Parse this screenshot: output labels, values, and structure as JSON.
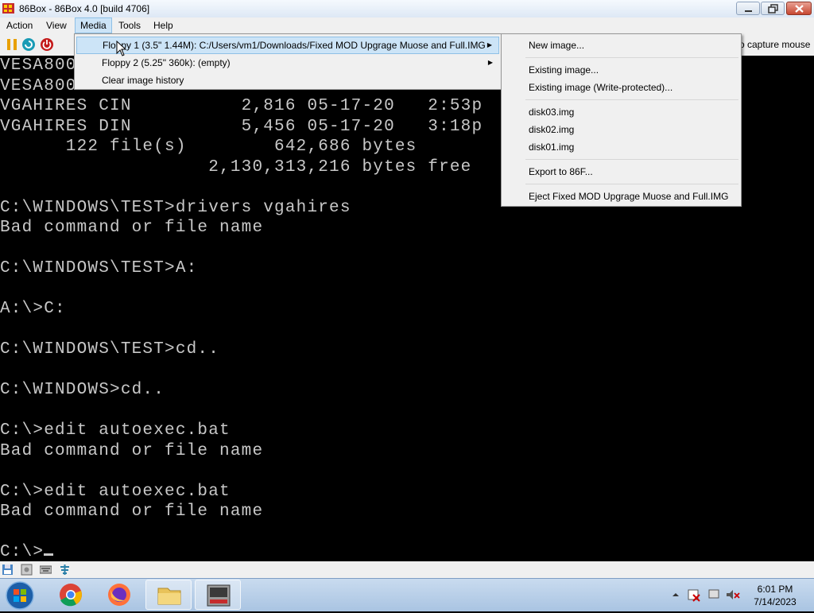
{
  "window": {
    "title": "86Box - 86Box 4.0 [build 4706]"
  },
  "menubar": {
    "items": [
      "Action",
      "View",
      "Media",
      "Tools",
      "Help"
    ]
  },
  "toolbar": {
    "capture_hint": "o capture mouse"
  },
  "media_menu": {
    "items": [
      {
        "label": "Floppy 1 (3.5\" 1.44M): C:/Users/vm1/Downloads/Fixed MOD Upgrage Muose and Full.IMG",
        "has_submenu": true
      },
      {
        "label": "Floppy 2 (5.25\" 360k): (empty)",
        "has_submenu": true
      },
      {
        "label": "Clear image history",
        "has_submenu": false
      }
    ]
  },
  "floppy_submenu": {
    "new_image": "New image...",
    "existing_image": "Existing image...",
    "existing_image_wp": "Existing image (Write-protected)...",
    "history": [
      "disk03.img",
      "disk02.img",
      "disk01.img"
    ],
    "export": "Export to 86F...",
    "eject": "Eject Fixed MOD Upgrage Muose and Full.IMG"
  },
  "dos_screen": {
    "lines": [
      "VESA800",
      "VESA800",
      "VGAHIRES CIN          2,816 05-17-20   2:53p",
      "VGAHIRES DIN          5,456 05-17-20   3:18p",
      "      122 file(s)        642,686 bytes",
      "                   2,130,313,216 bytes free",
      "",
      "C:\\WINDOWS\\TEST>drivers vgahires",
      "Bad command or file name",
      "",
      "C:\\WINDOWS\\TEST>A:",
      "",
      "A:\\>C:",
      "",
      "C:\\WINDOWS\\TEST>cd..",
      "",
      "C:\\WINDOWS>cd..",
      "",
      "C:\\>edit autoexec.bat",
      "Bad command or file name",
      "",
      "C:\\>edit autoexec.bat",
      "Bad command or file name",
      ""
    ],
    "prompt": "C:\\>"
  },
  "taskbar": {
    "clock_time": "6:01 PM",
    "clock_date": "7/14/2023"
  },
  "icons": [
    "app-86box-icon",
    "pause-icon",
    "reset-icon",
    "power-icon",
    "floppy-status-icon",
    "hdd-status-icon",
    "keyboard-status-icon",
    "network-status-icon",
    "start-orb-icon",
    "chrome-icon",
    "firefox-icon",
    "folder-icon",
    "86box-task-icon",
    "tray-arrow-icon",
    "action-center-icon",
    "network-tray-icon",
    "volume-muted-icon"
  ]
}
